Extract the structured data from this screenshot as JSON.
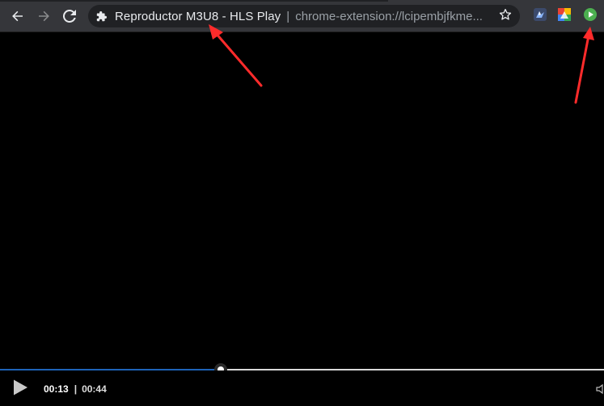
{
  "browser": {
    "tab_title": "Reproductor M3U8 - HLS Play",
    "url": "chrome-extension://lcipembjfkme...",
    "separator": "|",
    "toolbar_color": "#35363a",
    "omnibox_color": "#202124"
  },
  "extensions": [
    {
      "name": "bird-icon",
      "color": "#8ab4f8"
    },
    {
      "name": "photos-icon",
      "color": "#fbbc04"
    },
    {
      "name": "play-extension-icon",
      "color": "#34a853"
    }
  ],
  "player": {
    "current_time": "00:13",
    "time_separator": "|",
    "duration": "00:44",
    "progress": 0.365,
    "progress_color": "#1e63b8"
  },
  "annotations": {
    "arrow_color": "#ff2b2b"
  }
}
